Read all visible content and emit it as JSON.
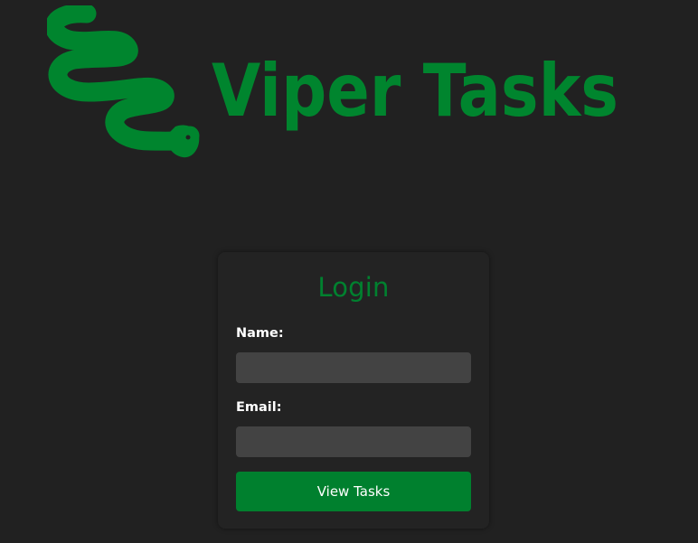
{
  "brand": {
    "name": "Viper Tasks",
    "logo_icon": "snake-icon",
    "color": "#00852e"
  },
  "login": {
    "title": "Login",
    "name_label": "Name:",
    "name_value": "",
    "email_label": "Email:",
    "email_value": "",
    "submit_label": "View Tasks"
  },
  "colors": {
    "background": "#212121",
    "card": "#232323",
    "input": "#434343",
    "accent": "#00802e"
  }
}
